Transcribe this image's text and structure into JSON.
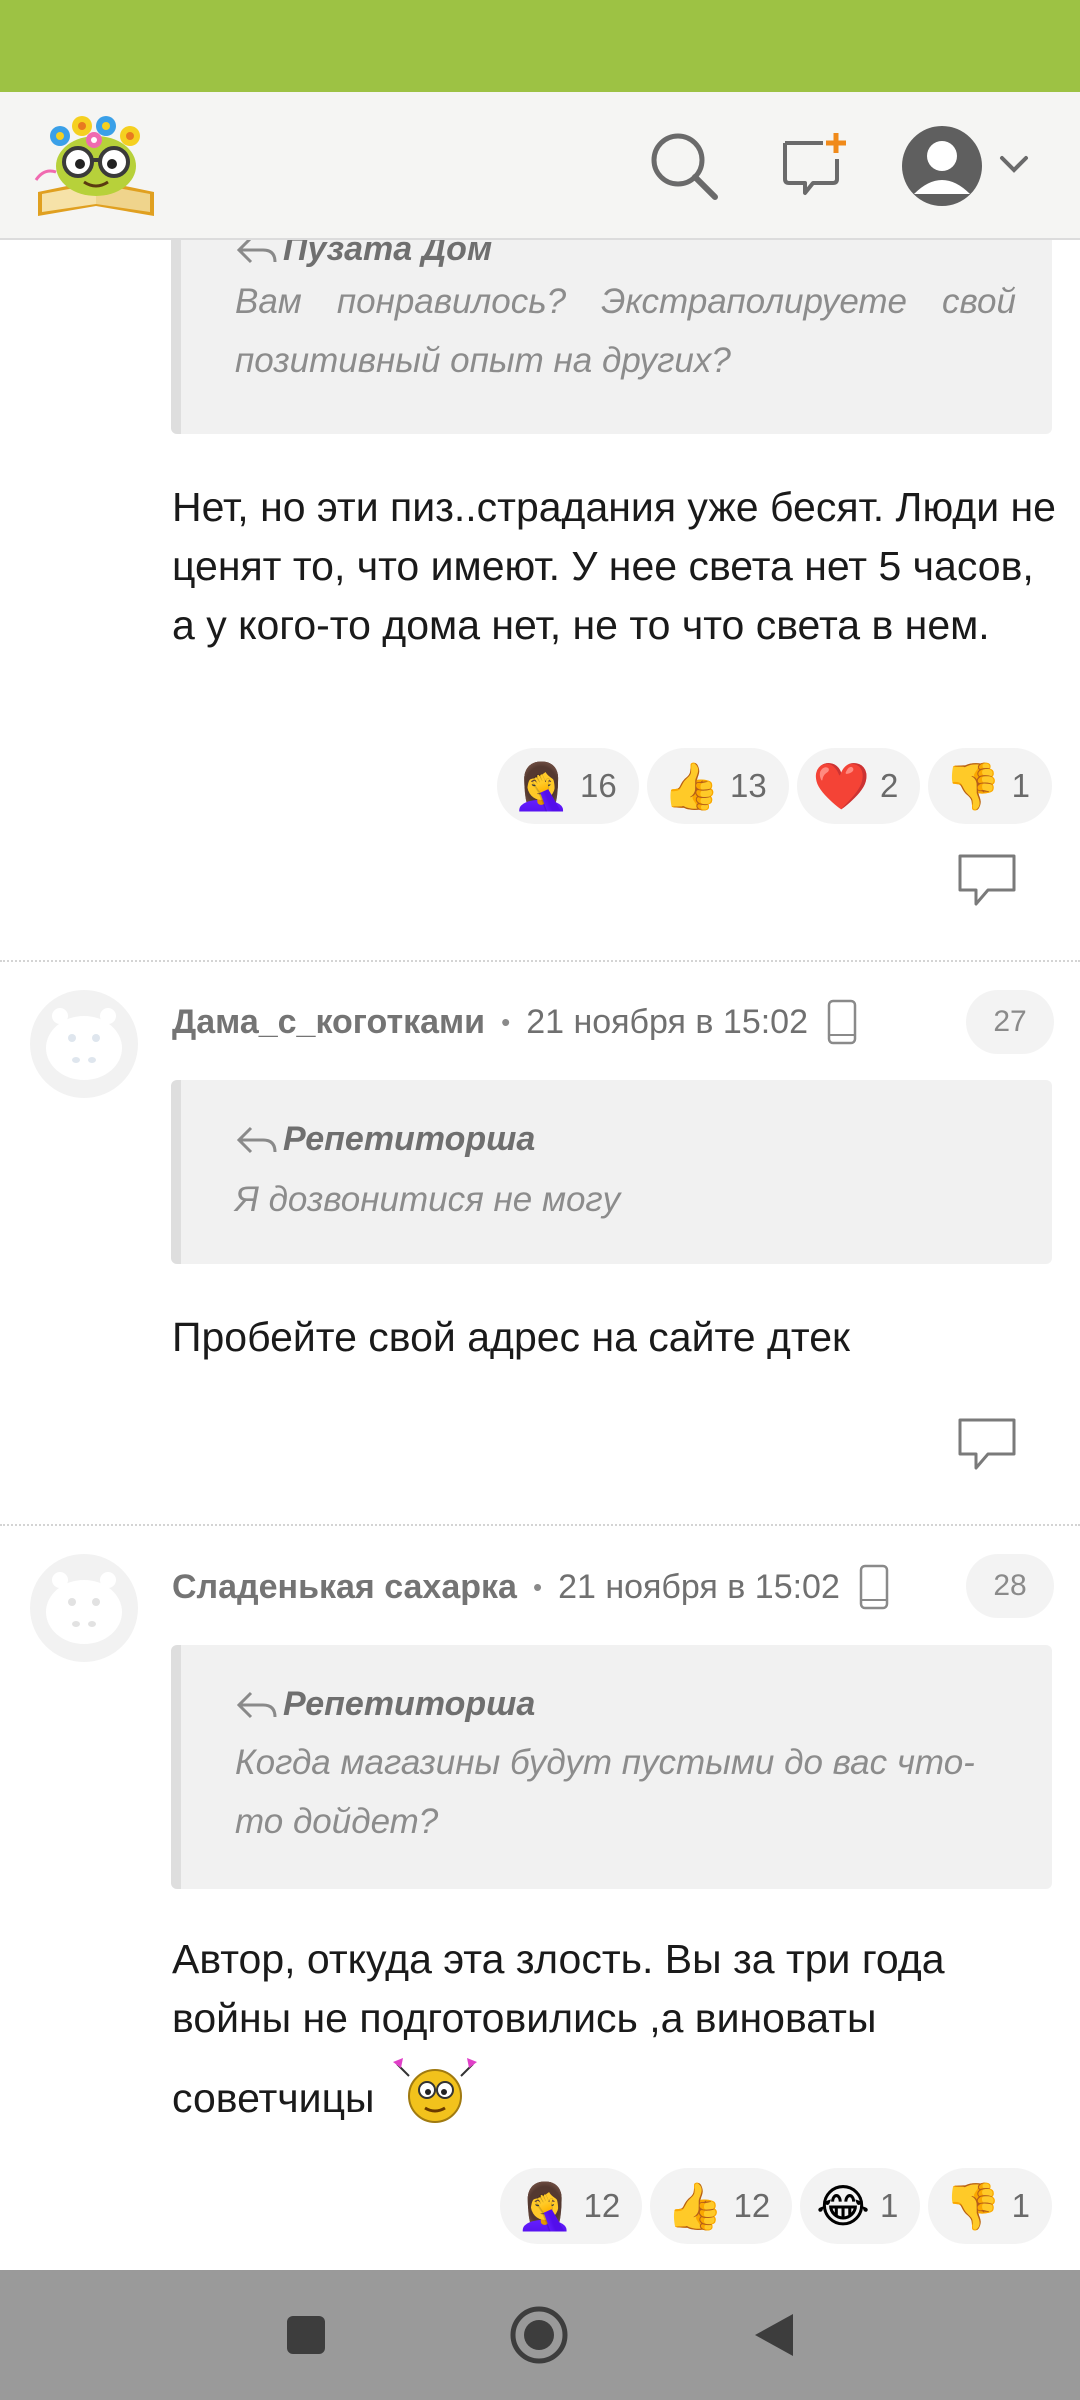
{
  "header": {
    "logo": "book-with-glasses-logo",
    "search_icon": "search-icon",
    "new_post_icon": "new-post-icon",
    "profile_icon": "user-avatar-icon"
  },
  "comments": [
    {
      "quote_author": "Пузата Дом",
      "quote_text": "Вам понравилось? Экстраполируете свой позитивный опыт на других?",
      "body": "Нет, но эти пиз..страдания уже бесят. Люди не ценят то, что имеют. У нее света нет 5 часов, а у кого-то дома нет, не то что света в нем.",
      "reactions": [
        {
          "emoji": "🤦‍♀️",
          "count": "16"
        },
        {
          "emoji": "👍",
          "count": "13"
        },
        {
          "emoji": "❤️",
          "count": "2"
        },
        {
          "emoji": "👎",
          "count": "1"
        }
      ]
    },
    {
      "author": "Дама_с_коготками",
      "date": "21 ноября в 15:02",
      "number": "27",
      "quote_author": "Репетиторша",
      "quote_text": "Я дозвонитися не могу",
      "body": "Пробейте свой адрес на сайте дтек"
    },
    {
      "author": "Сладенькая сахарка",
      "date": "21 ноября в 15:02",
      "number": "28",
      "quote_author": "Репетиторша",
      "quote_text": "Когда магазины будут пустыми до вас что-то дойдет?",
      "body_line1": "Автор, откуда эта злость. Вы за три года",
      "body_line2": "войны не подготовились ,а виноваты",
      "body_line3": "советчицы",
      "reactions": [
        {
          "emoji": "🤦‍♀️",
          "count": "12"
        },
        {
          "emoji": "👍",
          "count": "12"
        },
        {
          "emoji": "😂",
          "count": "1"
        },
        {
          "emoji": "👎",
          "count": "1"
        }
      ]
    }
  ],
  "nav": {
    "recent": "square-icon",
    "home": "home-circle-icon",
    "back": "back-triangle-icon"
  },
  "colors": {
    "status_bar": "#9dc244",
    "header_bg": "#f5f5f3",
    "quote_bg": "#f1f1f1",
    "nav_bar": "#9a9a9a"
  }
}
